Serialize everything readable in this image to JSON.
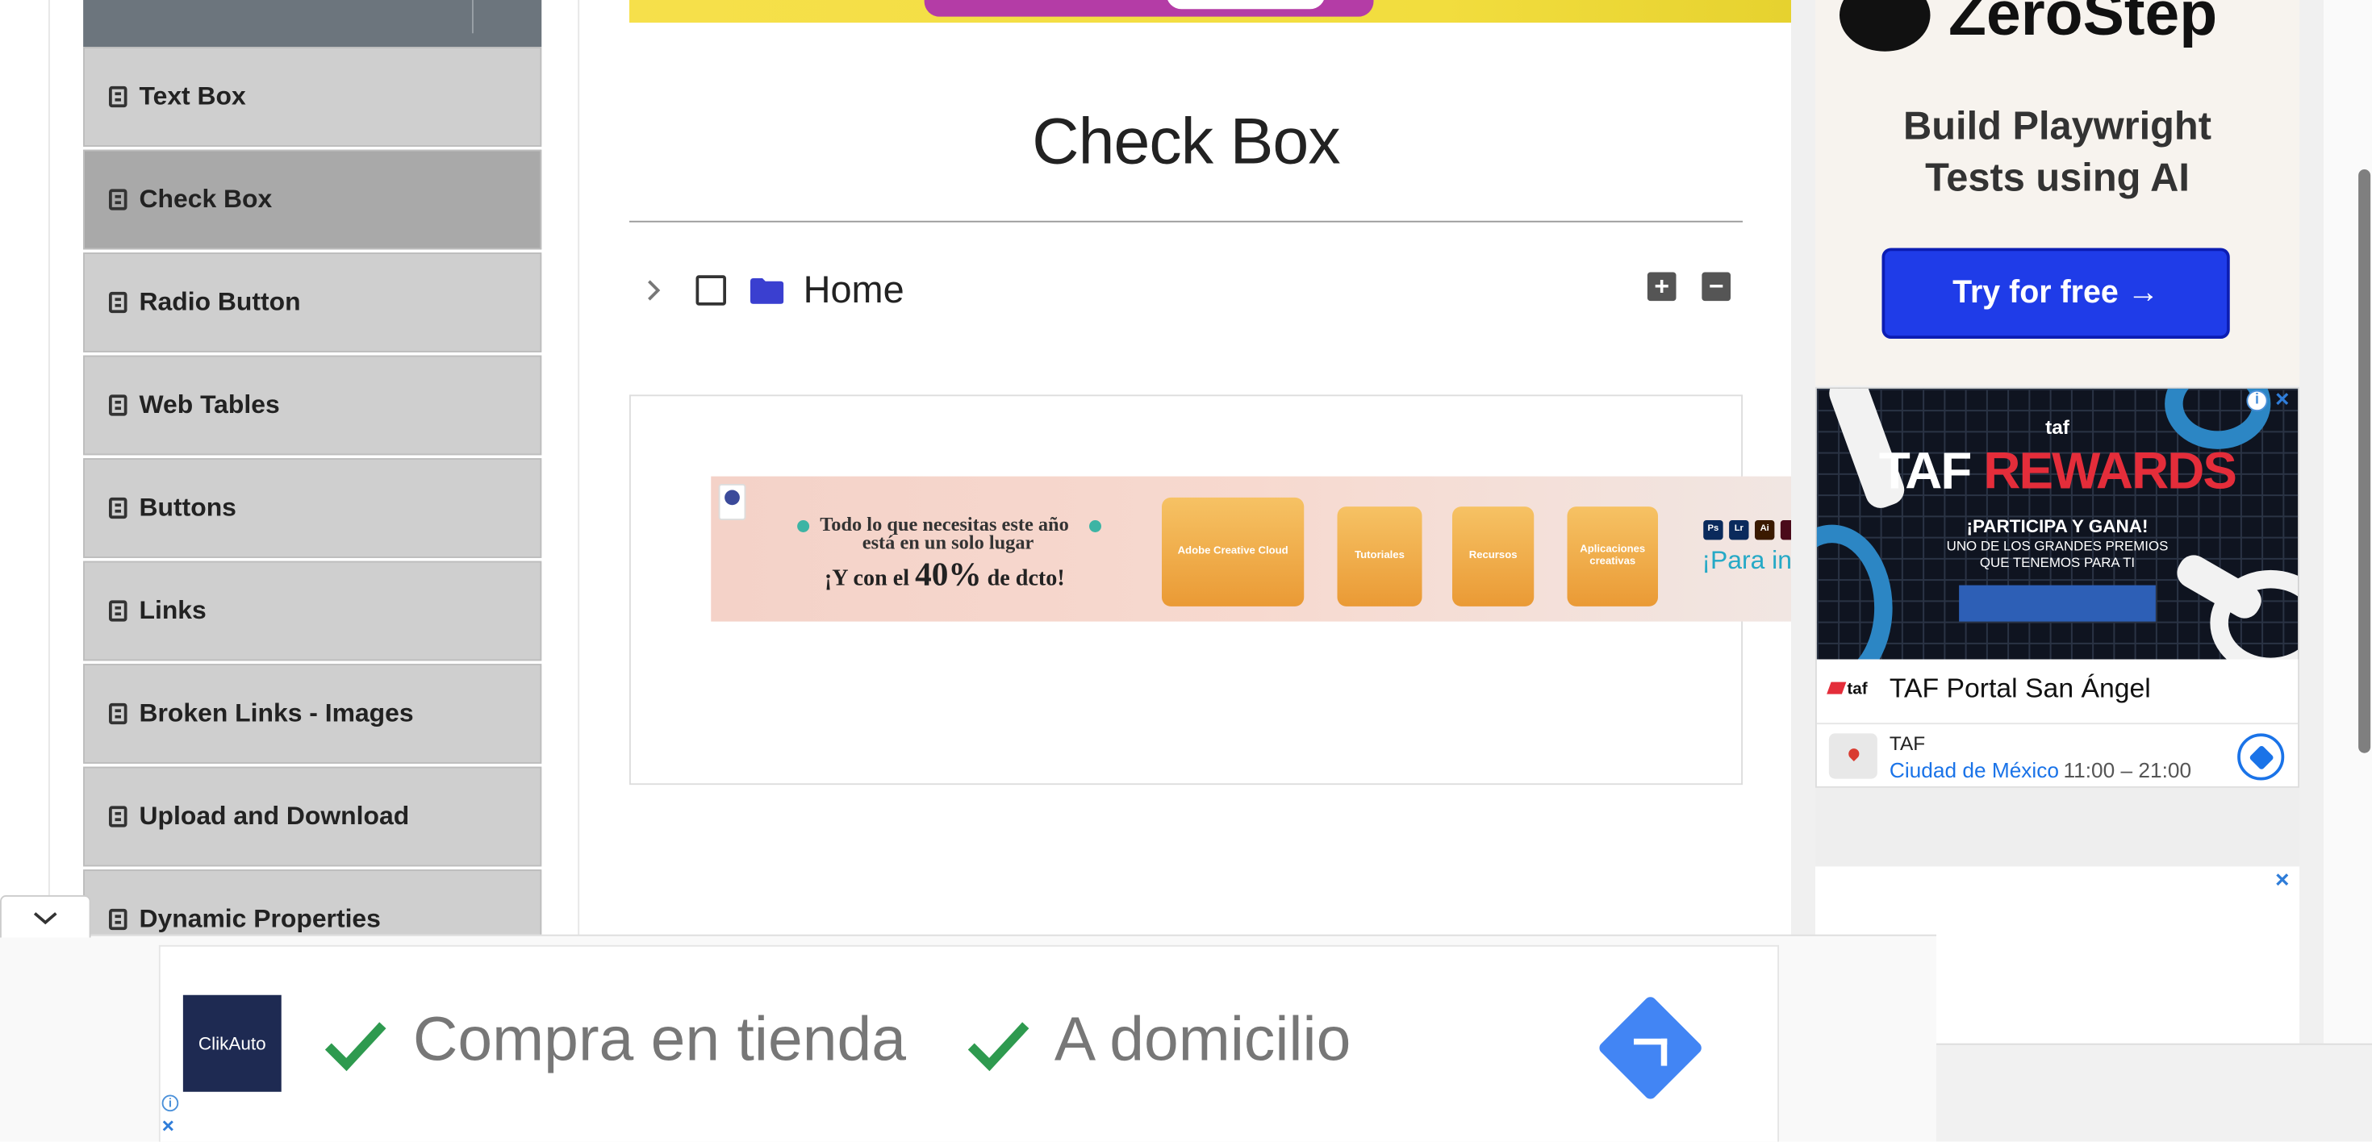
{
  "sidebar": {
    "items": [
      {
        "label": "Text Box"
      },
      {
        "label": "Check Box"
      },
      {
        "label": "Radio Button"
      },
      {
        "label": "Web Tables"
      },
      {
        "label": "Buttons"
      },
      {
        "label": "Links"
      },
      {
        "label": "Broken Links - Images"
      },
      {
        "label": "Upload and Download"
      },
      {
        "label": "Dynamic Properties"
      }
    ],
    "active_item": "Check Box"
  },
  "main": {
    "title": "Check Box",
    "tree": {
      "root_label": "Home",
      "checked": false,
      "expand_all_icon": "plus-square-icon",
      "collapse_all_icon": "minus-square-icon"
    }
  },
  "adobe_ad": {
    "line1": "Todo lo que necesitas este año",
    "line2": "está en un solo lugar",
    "line3_prefix": "¡Y con el ",
    "line3_big": "40%",
    "line3_suffix": " de dcto!",
    "cards": [
      "Adobe Creative Cloud",
      "Tutoriales",
      "Recursos",
      "Aplicaciones creativas"
    ],
    "apps": [
      "Ps",
      "Lr",
      "Ai",
      ""
    ],
    "tagline": "¡Para indi"
  },
  "zerostep_ad": {
    "brand": "ZeroStep",
    "tagline_line1": "Build Playwright",
    "tagline_line2": "Tests using AI",
    "cta": "Try for free →"
  },
  "taf_ad": {
    "brand": "taf",
    "headline_1": "TAF ",
    "headline_2": "REWARDS",
    "subhead": "¡PARTICIPA Y GANA!",
    "sub_line1": "UNO DE LOS GRANDES PREMIOS",
    "sub_line2": "QUE TENEMOS PARA TI",
    "place_name": "TAF Portal San Ángel",
    "logo_text": "taf",
    "short_name": "TAF",
    "city": "Ciudad de México",
    "hours": "11:00 – 21:00"
  },
  "bottom_ad": {
    "logo": "ClikAuto",
    "item1": "Compra en tienda",
    "item2": "A domicilio"
  },
  "colors": {
    "sidebar_item": "#cfcfcf",
    "sidebar_active": "#a9a9a9",
    "folder": "#3a3fd0",
    "zerostep_button": "#1f3ce8",
    "check_green": "#2e9a4f",
    "ad_blue": "#4285f4"
  }
}
